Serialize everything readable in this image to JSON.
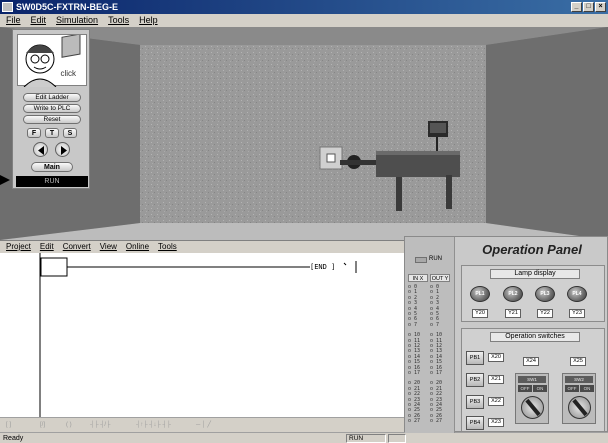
{
  "window": {
    "title": "SW0D5C-FXTRN-BEG-E"
  },
  "menu": [
    "File",
    "Edit",
    "Simulation",
    "Tools",
    "Help"
  ],
  "control_panel": {
    "avatar_label": "click",
    "buttons": {
      "edit_ladder": "Edit Ladder",
      "write_to_plc": "Write to PLC",
      "reset": "Reset",
      "main": "Main"
    },
    "speed_buttons": [
      "F",
      "T",
      "S"
    ],
    "mode": "RUN"
  },
  "editor": {
    "menu": [
      "Project",
      "Edit",
      "Convert",
      "View",
      "Online",
      "Tools"
    ],
    "end_label": "END"
  },
  "status": {
    "left": "Ready",
    "mode": "RUN"
  },
  "operation_panel": {
    "title": "Operation Panel",
    "run_label": "RUN",
    "io_headers": [
      "IN X",
      "OUT Y"
    ],
    "io_numbers": [
      [
        "0",
        "1",
        "2",
        "3",
        "4",
        "5",
        "6",
        "7"
      ],
      [
        "10",
        "11",
        "12",
        "13",
        "14",
        "15",
        "16",
        "17"
      ],
      [
        "20",
        "21",
        "22",
        "23",
        "24",
        "25",
        "26",
        "27"
      ]
    ],
    "lamp_display": {
      "header": "Lamp display",
      "lamps": [
        {
          "name": "PL1",
          "addr": "Y20"
        },
        {
          "name": "PL2",
          "addr": "Y21"
        },
        {
          "name": "PL3",
          "addr": "Y22"
        },
        {
          "name": "PL4",
          "addr": "Y23"
        }
      ]
    },
    "operation_switches": {
      "header": "Operation switches",
      "push_buttons": [
        {
          "name": "PB1",
          "addr": "X20"
        },
        {
          "name": "PB2",
          "addr": "X21"
        },
        {
          "name": "PB3",
          "addr": "X22"
        },
        {
          "name": "PB4",
          "addr": "X23"
        }
      ],
      "selector_switches": [
        {
          "name": "SW1",
          "addr": "X24",
          "off": "OFF",
          "on": "ON"
        },
        {
          "name": "SW2",
          "addr": "X25",
          "off": "OFF",
          "on": "ON"
        }
      ]
    }
  }
}
